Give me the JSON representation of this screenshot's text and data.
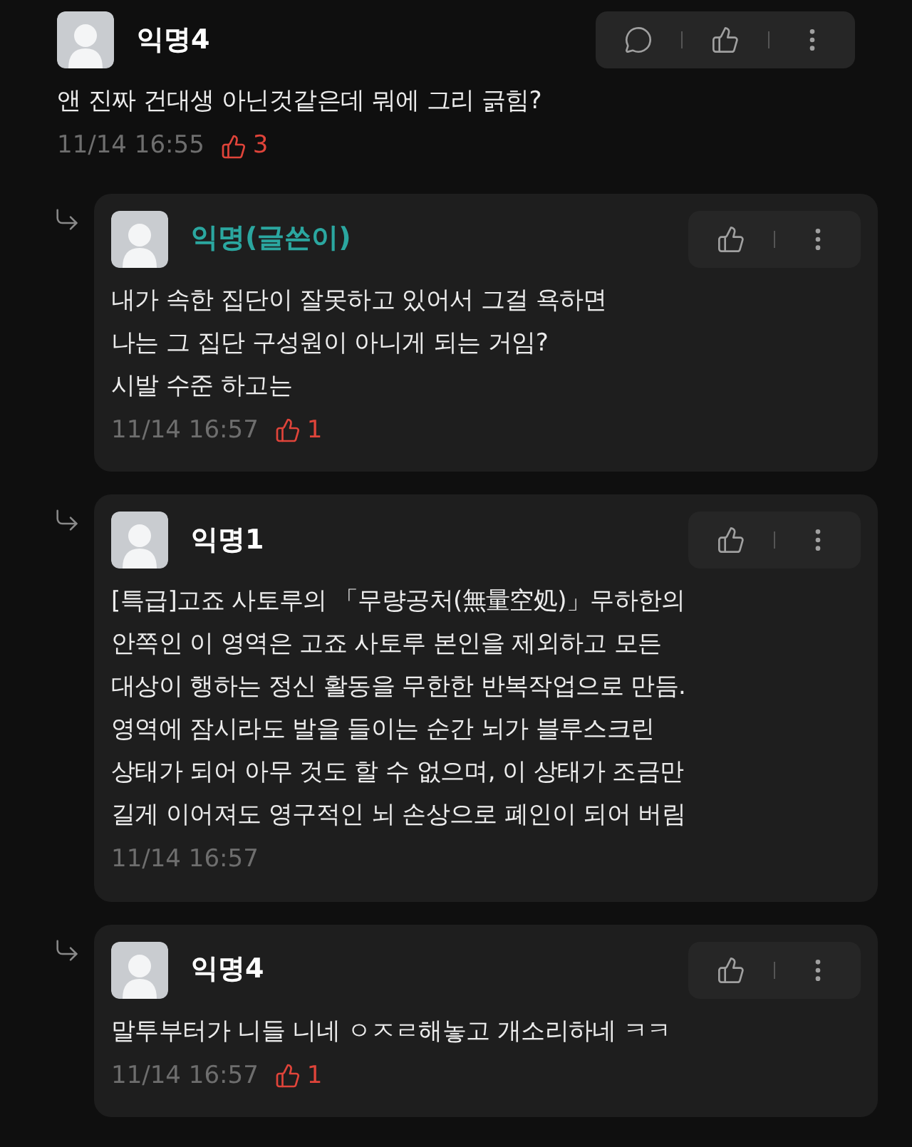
{
  "comments": [
    {
      "kind": "comment",
      "author": "익명4",
      "is_writer": false,
      "body": "앤 진짜 건대생 아닌것같은데 뭐에 그리 긁힘?",
      "time": "11/14 16:55",
      "likes": "3",
      "has_reply_button": true
    },
    {
      "kind": "reply",
      "author": "익명(글쓴이)",
      "is_writer": true,
      "body": "내가 속한 집단이 잘못하고 있어서 그걸 욕하면\n나는 그 집단 구성원이 아니게 되는 거임?\n시발 수준 하고는",
      "time": "11/14 16:57",
      "likes": "1",
      "has_reply_button": false
    },
    {
      "kind": "reply",
      "author": "익명1",
      "is_writer": false,
      "body": "[특급]고죠 사토루의 「무량공처(無量空処)」무하한의\n안쪽인 이 영역은 고죠 사토루 본인을 제외하고 모든\n대상이 행하는 정신 활동을 무한한 반복작업으로 만듬.\n영역에 잠시라도 발을 들이는 순간 뇌가 블루스크린\n상태가 되어 아무 것도 할 수 없으며, 이 상태가 조금만\n길게 이어져도 영구적인 뇌 손상으로 폐인이 되어 버림",
      "time": "11/14 16:57",
      "has_reply_button": false
    },
    {
      "kind": "reply",
      "author": "익명4",
      "is_writer": false,
      "body": "말투부터가 니들 니네 ㅇㅈㄹ해놓고 개소리하네 ㅋㅋ",
      "time": "11/14 16:57",
      "likes": "1",
      "has_reply_button": false
    }
  ]
}
